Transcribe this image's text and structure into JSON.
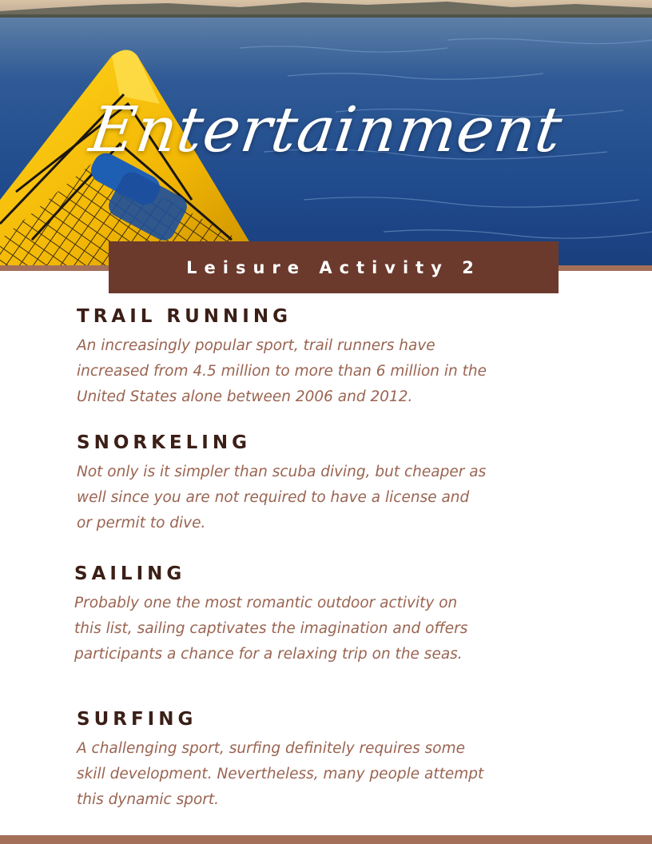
{
  "hero": {
    "title": "Entertainment"
  },
  "banner": {
    "label": "Leisure Activity 2"
  },
  "sections": [
    {
      "heading": "TRAIL RUNNING",
      "lines": [
        "An increasingly popular sport, trail runners have",
        "increased from 4.5 million to more than 6 million in the",
        "United States alone between 2006 and 2012."
      ]
    },
    {
      "heading": "SNORKELING",
      "lines": [
        "Not only is it simpler than scuba diving, but cheaper as",
        "well since you are not required to have a license and",
        "or permit to dive."
      ]
    },
    {
      "heading": "SAILING",
      "lines": [
        "Probably one the most romantic outdoor activity on",
        "this list, sailing captivates the imagination and offers",
        "participants a chance for a relaxing trip on the seas."
      ]
    },
    {
      "heading": "SURFING",
      "lines": [
        "A challenging sport, surfing definitely requires some",
        "skill development. Nevertheless, many people attempt",
        "this dynamic sport."
      ]
    }
  ],
  "colors": {
    "banner_bg": "#6b3a2c",
    "heading": "#3b1f17",
    "body_text": "#9a6451",
    "accent_strip": "#a4705a"
  }
}
